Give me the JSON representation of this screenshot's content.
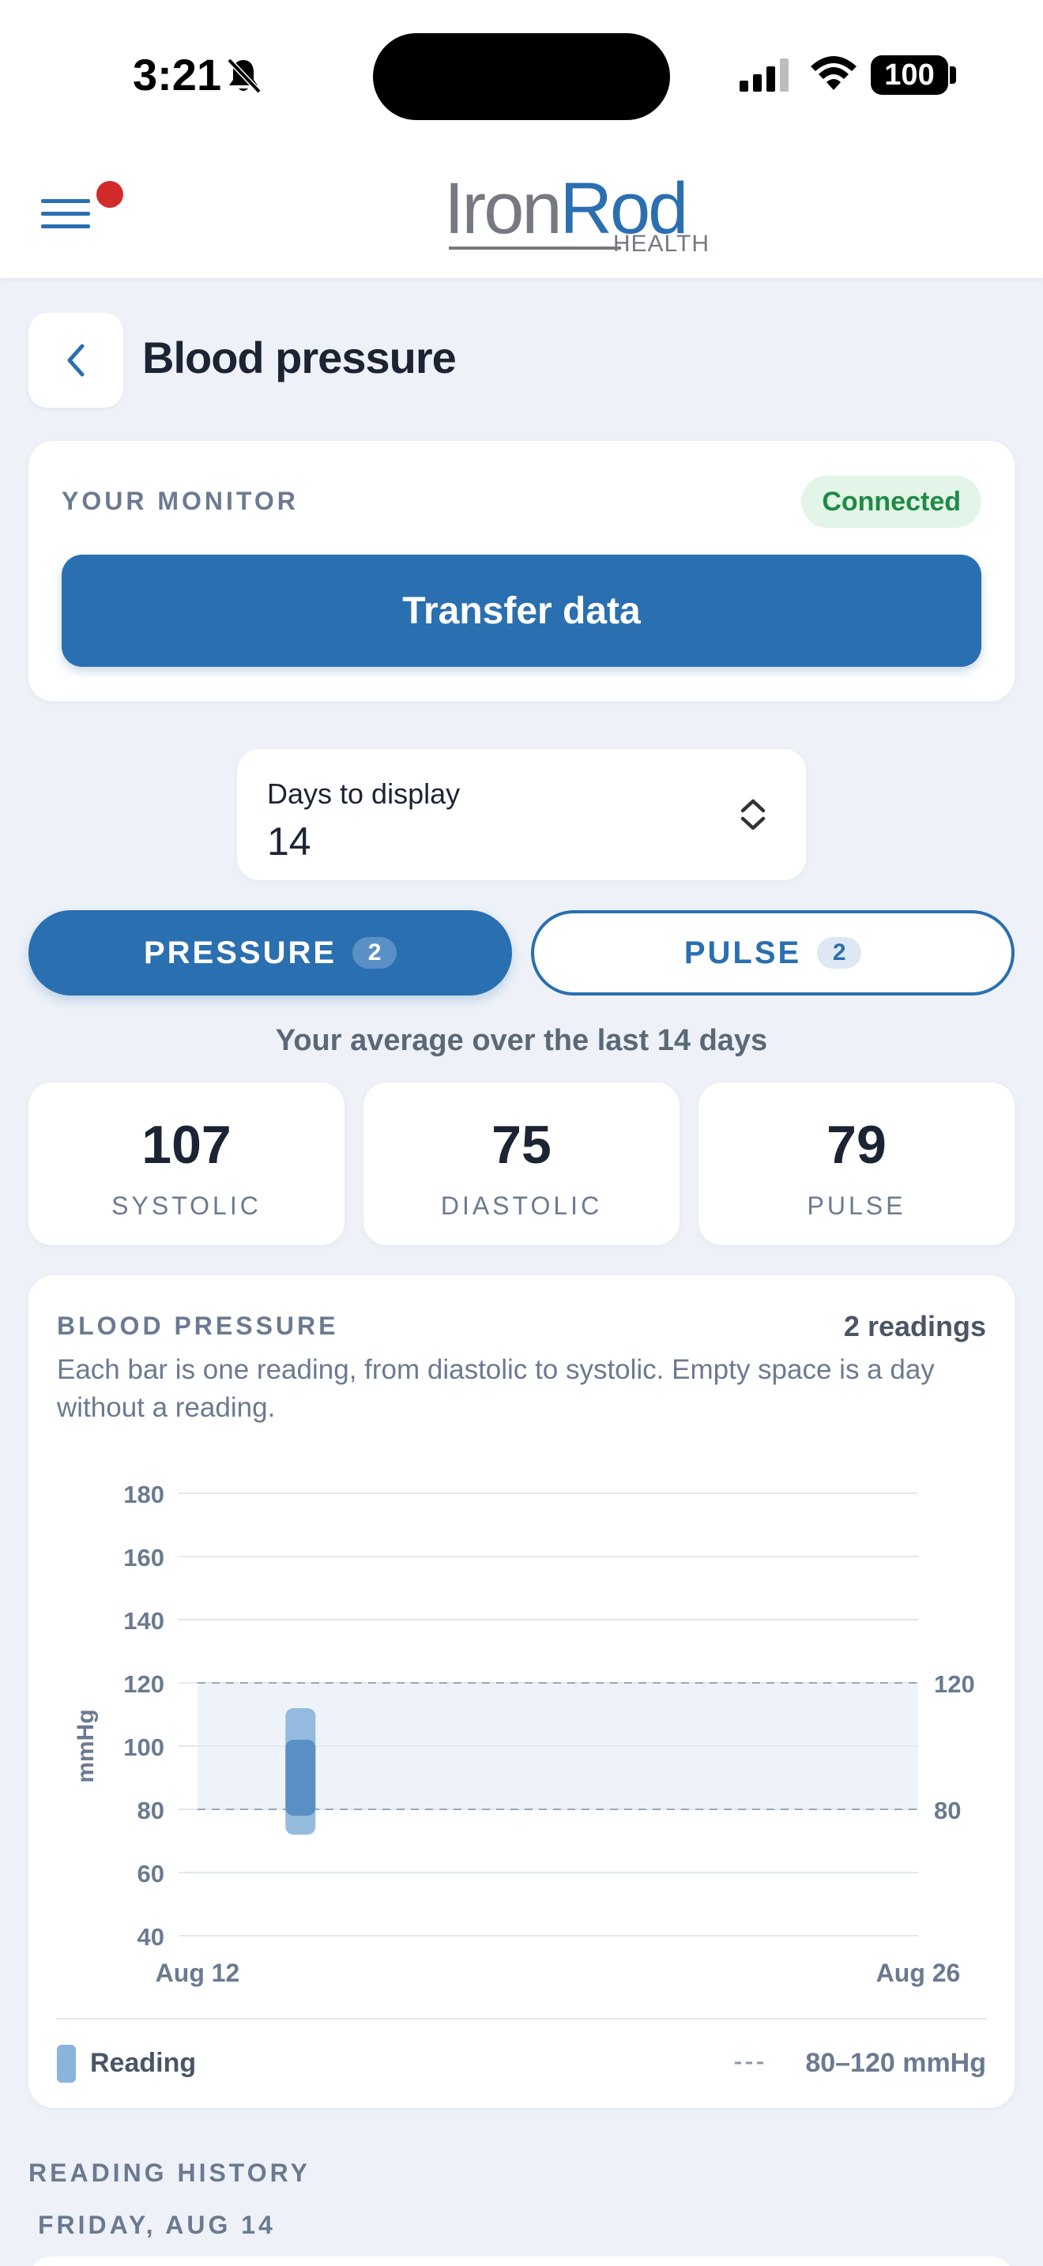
{
  "status_bar": {
    "time": "3:21",
    "battery": "100",
    "icons": [
      "bell-slash-icon",
      "cellular-signal-icon",
      "wifi-icon",
      "battery-icon"
    ]
  },
  "header": {
    "logo_iron": "Iron",
    "logo_rod": "Rod",
    "logo_health": "HEALTH",
    "notification_dot_color": "#d32a2a",
    "brand_color": "#2a6fb0"
  },
  "page": {
    "title": "Blood pressure"
  },
  "monitor": {
    "label": "YOUR MONITOR",
    "status": "Connected",
    "button_label": "Transfer data"
  },
  "days_select": {
    "label": "Days to display",
    "value": "14"
  },
  "tabs": [
    {
      "label": "PRESSURE",
      "count": "2",
      "selected": true
    },
    {
      "label": "PULSE",
      "count": "2",
      "selected": false
    }
  ],
  "averages": {
    "caption": "Your average over the last 14 days",
    "stats": [
      {
        "value": "107",
        "label": "SYSTOLIC"
      },
      {
        "value": "75",
        "label": "DIASTOLIC"
      },
      {
        "value": "79",
        "label": "PULSE"
      }
    ]
  },
  "chart_card": {
    "title": "BLOOD PRESSURE",
    "readings": "2 readings",
    "description": "Each bar is one reading, from diastolic to systolic. Empty space is a day without a reading.",
    "legend_reading": "Reading",
    "legend_range": "80–120 mmHg"
  },
  "chart_data": {
    "type": "bar",
    "subtype": "floating-range",
    "ylabel": "mmHg",
    "ylim": [
      40,
      180
    ],
    "yticks": [
      180,
      160,
      140,
      120,
      100,
      80,
      60,
      40
    ],
    "x_labels": [
      "Aug 12",
      "Aug 26"
    ],
    "x_range": [
      "Aug 12",
      "Aug 26"
    ],
    "target_band": {
      "low": 80,
      "high": 120,
      "low_label": "80",
      "high_label": "120"
    },
    "series": [
      {
        "name": "Reading",
        "bars": [
          {
            "x": "Aug 14",
            "low": 72,
            "high": 112
          },
          {
            "x": "Aug 14",
            "low": 78,
            "high": 102
          }
        ]
      }
    ],
    "grid": true,
    "colors": {
      "bar_light": "#8ab4dc",
      "bar_dark": "#4f87bf",
      "band": "#eef3f9"
    }
  },
  "history": {
    "label": "READING HISTORY",
    "date": "FRIDAY, AUG 14"
  }
}
